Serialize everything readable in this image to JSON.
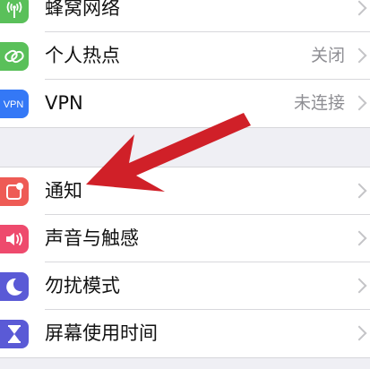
{
  "settings": {
    "group1": [
      {
        "label": "蜂窝网络",
        "value": "",
        "icon": "antenna-icon",
        "color": "#5ac05a"
      },
      {
        "label": "个人热点",
        "value": "关闭",
        "icon": "hotspot-link-icon",
        "color": "#5ac05a"
      },
      {
        "label": "VPN",
        "value": "未连接",
        "icon": "vpn-icon",
        "color": "#3478f6"
      }
    ],
    "group2": [
      {
        "label": "通知",
        "value": "",
        "icon": "notifications-icon",
        "color": "#ee5b55"
      },
      {
        "label": "声音与触感",
        "value": "",
        "icon": "speaker-icon",
        "color": "#ee4a6d"
      },
      {
        "label": "勿扰模式",
        "value": "",
        "icon": "moon-icon",
        "color": "#5a5ad6"
      },
      {
        "label": "屏幕使用时间",
        "value": "",
        "icon": "hourglass-icon",
        "color": "#5a5ad6"
      }
    ],
    "vpn_icon_text": "VPN"
  },
  "annotation": {
    "color": "#d02028",
    "icon": "red-arrow-icon"
  }
}
